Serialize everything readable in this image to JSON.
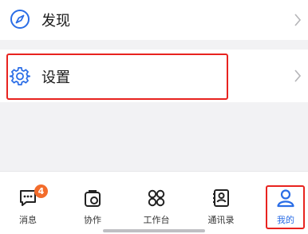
{
  "menu": {
    "discover_label": "发现",
    "settings_label": "设置"
  },
  "tabbar": {
    "items": [
      {
        "label": "消息",
        "icon": "message-icon"
      },
      {
        "label": "协作",
        "icon": "collaborate-icon"
      },
      {
        "label": "工作台",
        "icon": "workbench-icon"
      },
      {
        "label": "通讯录",
        "icon": "contacts-icon"
      },
      {
        "label": "我的",
        "icon": "profile-icon",
        "active": true
      }
    ],
    "messages_badge": "4"
  },
  "colors": {
    "accent": "#2a6de6",
    "highlight": "#e8231f",
    "badge": "#f36c2b"
  }
}
